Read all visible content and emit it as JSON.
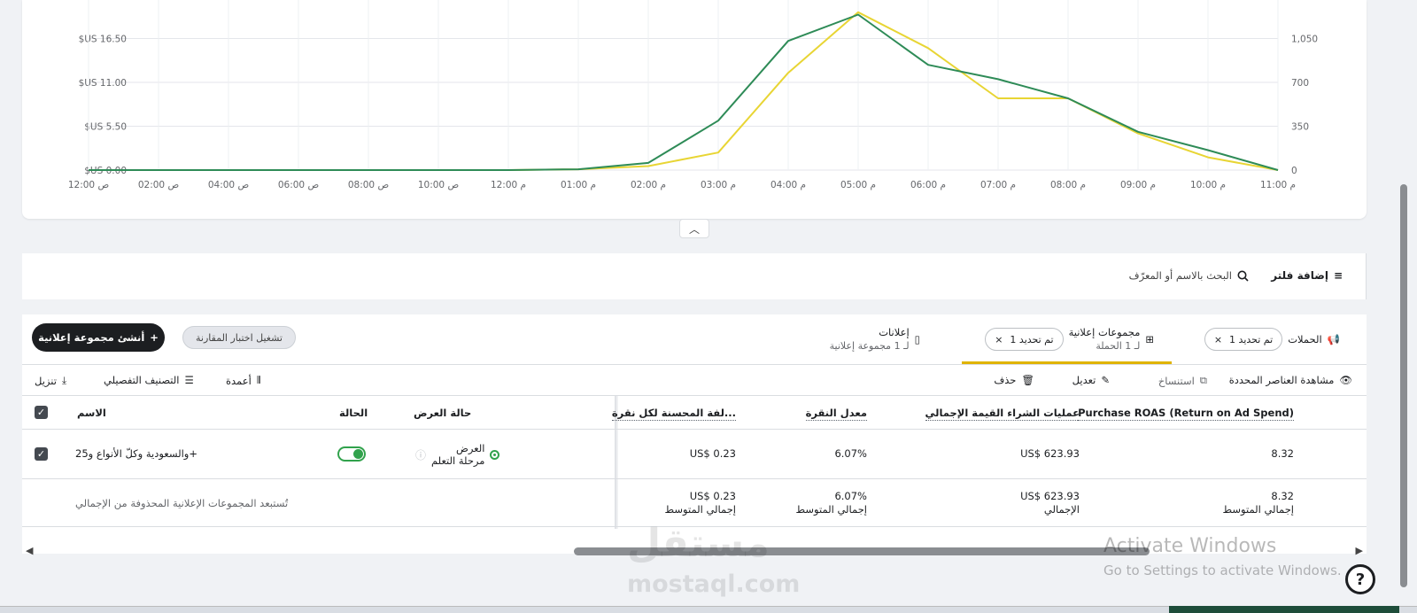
{
  "chart_data": {
    "type": "line",
    "x": [
      "12:00 ص",
      "02:00 ص",
      "04:00 ص",
      "06:00 ص",
      "08:00 ص",
      "10:00 ص",
      "12:00 م",
      "01:00 م",
      "02:00 م",
      "03:00 م",
      "04:00 م",
      "05:00 م",
      "06:00 م",
      "07:00 م",
      "08:00 م",
      "09:00 م",
      "10:00 م",
      "11:00 م"
    ],
    "x_axis_labels": [
      "12:00 ص",
      "02:00 ص",
      "04:00 ص",
      "06:00 ص",
      "08:00 ص",
      "10:00 ص",
      "12:00 م",
      "01:00 م",
      "02:00 م",
      "03:00 م",
      "04:00 م",
      "05:00 م",
      "06:00 م",
      "07:00 م",
      "08:00 م",
      "09:00 م",
      "10:00 م",
      "11:00 م"
    ],
    "y_left_ticks": [
      "$US 16.50",
      "$US 11.00",
      "$US 5.50",
      "$US 0.00"
    ],
    "y_right_ticks": [
      "1,050",
      "700",
      "350",
      "0"
    ],
    "ylim_left": [
      0,
      16.5
    ],
    "ylim_right": [
      0,
      1050
    ],
    "series": [
      {
        "color": "#2e8b57",
        "axis": "left",
        "values": [
          0,
          0,
          0,
          0,
          0,
          0,
          0,
          0.1,
          0.9,
          6.2,
          16.2,
          19.5,
          13.2,
          11.4,
          9.0,
          4.8,
          2.5,
          0
        ]
      },
      {
        "color": "#e8d534",
        "axis": "left",
        "values": [
          0,
          0,
          0,
          0,
          0,
          0,
          0,
          0.1,
          0.5,
          2.2,
          12.2,
          19.8,
          15.3,
          9.0,
          9.0,
          4.6,
          1.6,
          0
        ]
      }
    ],
    "grid": true,
    "legend": "none"
  },
  "filter": {
    "add_filter_label": "إضافة فلتر",
    "search_placeholder": "البحث بالاسم أو المعرّف"
  },
  "actions": {
    "create_label": "أنشئ مجموعة إعلانية",
    "compare_label": "تشغيل اختبار المقارنة"
  },
  "levels": {
    "campaigns": {
      "label": "الحملات",
      "chip": "تم تحديد 1"
    },
    "adsets": {
      "label": "مجموعات إعلانية",
      "sub": "لـ 1 الحملة",
      "chip": "تم تحديد 1"
    },
    "ads": {
      "label": "إعلانات",
      "sub": "لـ 1 مجموعة إعلانية"
    }
  },
  "toolbar": {
    "view_selected": "مشاهدة العناصر المحددة",
    "duplicate": "استنساخ",
    "edit": "تعديل",
    "delete": "حذف",
    "columns": "أعمدة",
    "breakdown": "التصنيف التفصيلي",
    "export": "تنزيل"
  },
  "table": {
    "headers": {
      "name": "الاسم",
      "status": "الحالة",
      "delivery": "حالة العرض",
      "cpc": "...لفة المحسنة لكل نقرة",
      "ctr": "معدل النقرة",
      "purchase_value": "عمليات الشراء القيمة الإجمالي",
      "roas": "Purchase ROAS (Return on Ad Spend)"
    },
    "row": {
      "name": "+والسعودية وكلّ الأنواع و25",
      "delivery": "العرض",
      "delivery_sub": "مرحلة التعلم",
      "cpc": "US$ 0.23",
      "ctr": "6.07%",
      "purchase_value": "US$ 623.93",
      "roas": "8.32"
    },
    "summary": {
      "note": "تُستبعد المجموعات الإعلانية المحذوفة من الإجمالي",
      "cpc": "US$ 0.23",
      "cpc_sub": "إجمالي المتوسط",
      "ctr": "6.07%",
      "ctr_sub": "إجمالي المتوسط",
      "purchase_value": "US$ 623.93",
      "purchase_value_sub": "الإجمالي",
      "roas": "8.32",
      "roas_sub": "إجمالي المتوسط"
    }
  },
  "overlay": {
    "watermark": "مستقل",
    "watermark_sub": "mostaql.com",
    "activate_title": "Activate Windows",
    "activate_sub": "Go to Settings to activate Windows."
  }
}
